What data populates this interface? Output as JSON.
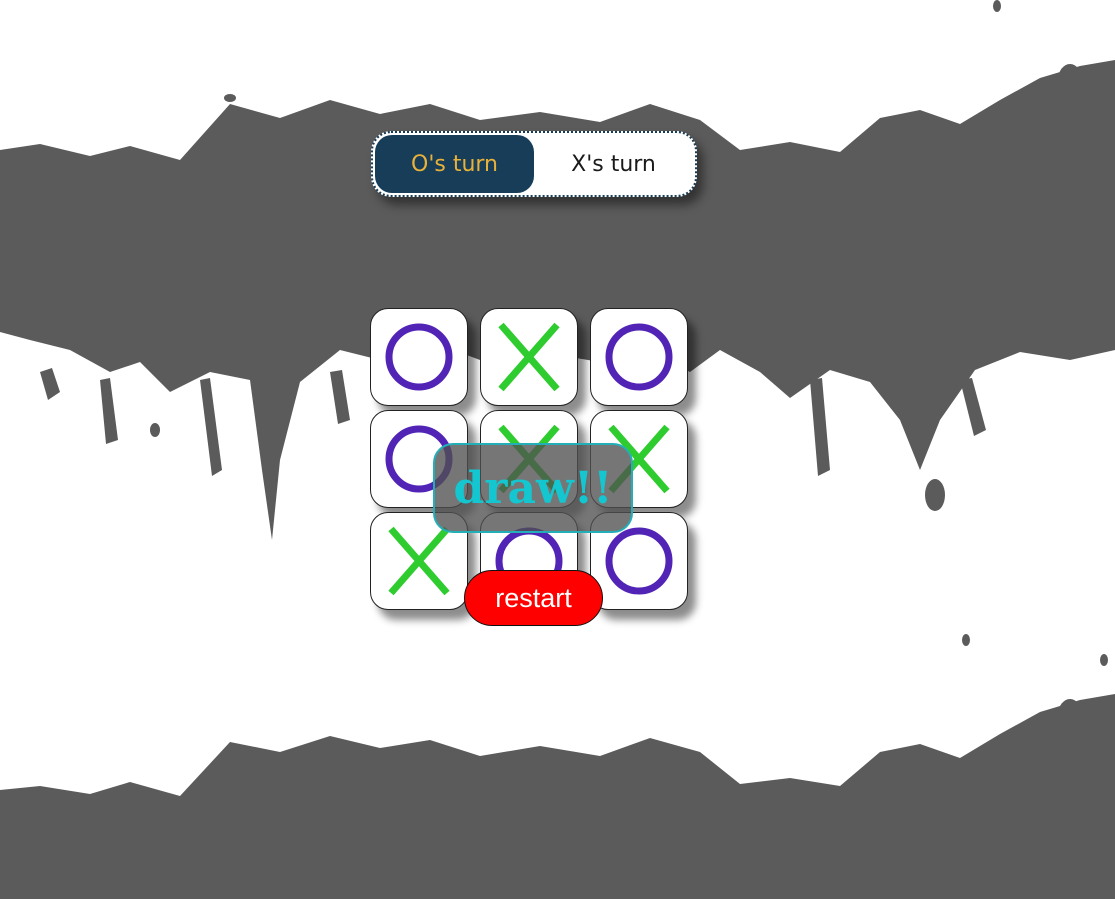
{
  "colors": {
    "background": "#ffffff",
    "paint": "#5b5b5b",
    "o_mark": "#5224b6",
    "x_mark": "#2ecc2e",
    "active_turn_bg": "#173d59",
    "active_turn_text": "#e8b13a",
    "result_text": "#13c6cf",
    "restart_bg": "#ff0000"
  },
  "turn_toggle": {
    "o_label": "O's turn",
    "x_label": "X's turn",
    "active": "O"
  },
  "board": {
    "cells": [
      "O",
      "X",
      "O",
      "O",
      "X",
      "X",
      "X",
      "O",
      "O"
    ]
  },
  "result": {
    "text": "draw!!"
  },
  "restart": {
    "label": "restart"
  }
}
